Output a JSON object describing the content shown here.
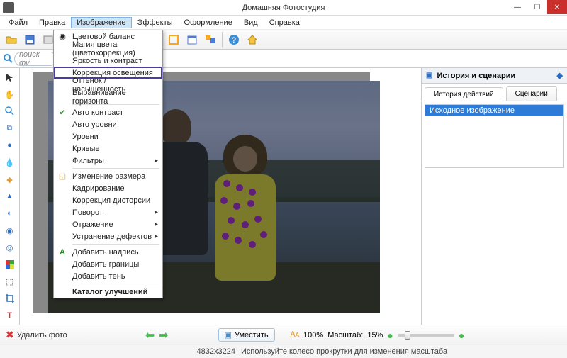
{
  "window": {
    "title": "Домашняя Фотостудия"
  },
  "menu": {
    "file": "Файл",
    "edit": "Правка",
    "image": "Изображение",
    "effects": "Эффекты",
    "decor": "Оформление",
    "view": "Вид",
    "help": "Справка"
  },
  "search": {
    "placeholder": "поиск фу"
  },
  "dropdown": {
    "color_balance": "Цветовой баланс",
    "color_magic": "Магия цвета (цветокоррекция)",
    "brightness_contrast": "Яркость и контраст",
    "lighting_correction": "Коррекция освещения",
    "hue_saturation": "Оттенок / насыщенность",
    "horizon": "Выравнивание горизонта",
    "auto_contrast": "Авто контраст",
    "auto_levels": "Авто уровни",
    "levels": "Уровни",
    "curves": "Кривые",
    "filters": "Фильтры",
    "resize": "Изменение размера",
    "crop": "Кадрирование",
    "distortion": "Коррекция дисторсии",
    "rotate": "Поворот",
    "reflect": "Отражение",
    "defects": "Устранение дефектов",
    "add_text": "Добавить надпись",
    "add_border": "Добавить границы",
    "add_shadow": "Добавить тень",
    "catalog": "Каталог улучшений"
  },
  "panel": {
    "title": "История и сценарии",
    "tab_history": "История действий",
    "tab_scenarios": "Сценарии",
    "row_original": "Исходное изображение"
  },
  "bottom": {
    "delete": "Удалить фото",
    "fit": "Уместить",
    "zoom_100": "100%",
    "scale_label": "Масштаб:",
    "scale_value": "15%"
  },
  "status": {
    "dimensions": "4832x3224",
    "hint": "Используйте колесо прокрутки для изменения масштаба"
  }
}
